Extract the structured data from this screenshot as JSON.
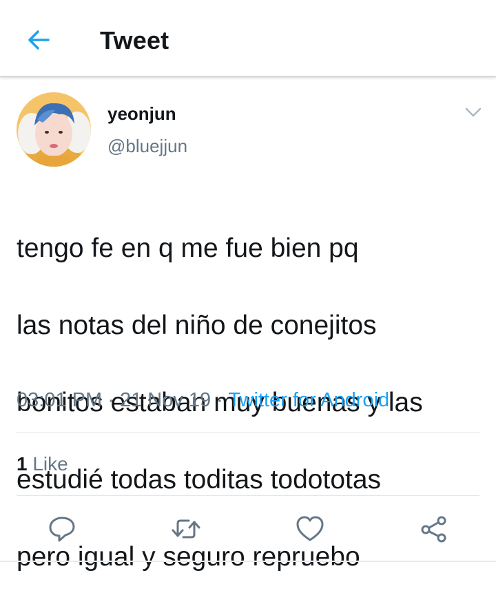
{
  "header": {
    "title": "Tweet",
    "back_icon": "arrow-left-icon",
    "accent_color": "#1da1f2"
  },
  "author": {
    "name": "yeonjun",
    "handle": "@bluejjun",
    "avatar": "avatar-photo"
  },
  "tweet": {
    "lines": [
      "tengo fe en q me fue bien pq",
      "las notas del niño de conejitos",
      "bonitos estaban muy buenas y las",
      "estudié todas toditas todototas",
      "pero igual y seguro repruebo"
    ],
    "time": "03:01 PM",
    "date": "21 Nov 19",
    "separator": "·",
    "source": "Twitter for Android"
  },
  "stats": {
    "likes_count": "1",
    "likes_label": "Like"
  },
  "actions": [
    {
      "icon": "reply-icon"
    },
    {
      "icon": "retweet-icon"
    },
    {
      "icon": "like-heart-icon"
    },
    {
      "icon": "share-icon"
    }
  ],
  "colors": {
    "text": "#14171a",
    "secondary": "#657786",
    "link": "#1da1f2",
    "icon": "#657786"
  }
}
